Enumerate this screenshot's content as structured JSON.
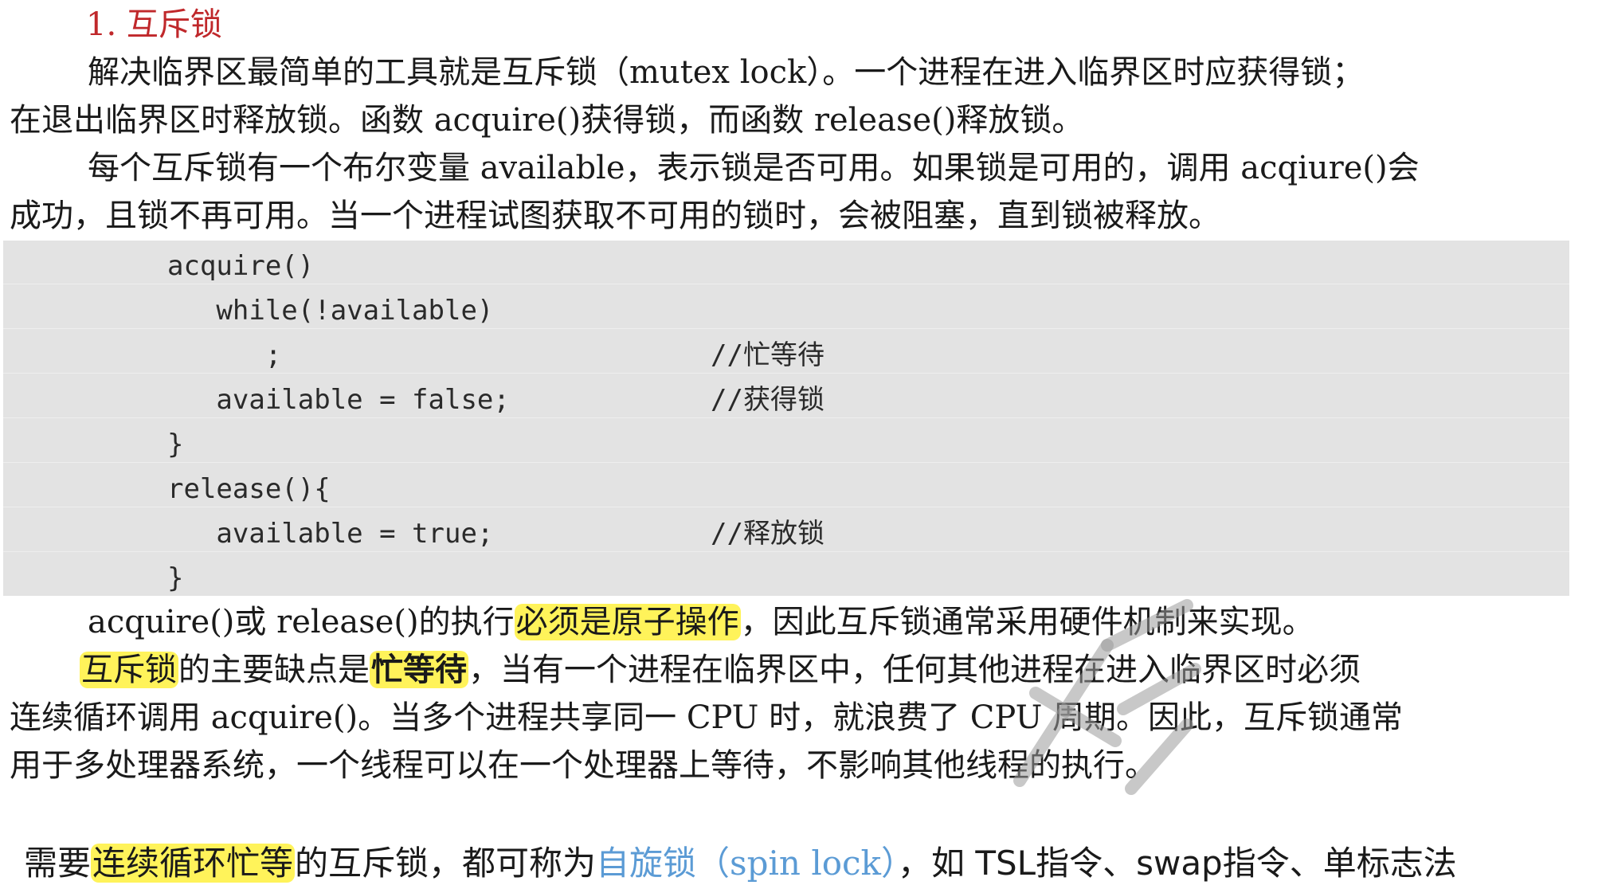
{
  "heading": "1. 互斥锁",
  "p1": {
    "line1": "解决临界区最简单的工具就是互斥锁（mutex lock）。一个进程在进入临界区时应获得锁；",
    "line2": "在退出临界区时释放锁。函数 acquire()获得锁，而函数 release()释放锁。"
  },
  "p2": {
    "line1": "每个互斥锁有一个布尔变量 available，表示锁是否可用。如果锁是可用的，调用 acqiure()会",
    "line2": "成功，且锁不再可用。当一个进程试图获取不可用的锁时，会被阻塞，直到锁被释放。"
  },
  "code": {
    "lines": [
      "acquire()",
      "   while(!available)",
      "      ;",
      "   available = false;",
      "}",
      "release(){",
      "   available = true;",
      "}"
    ],
    "comments": {
      "busy_wait": "//忙等待",
      "acquire_lock": "//获得锁",
      "release_lock": "//释放锁"
    }
  },
  "p3": {
    "before": "acquire()或 release()的执行",
    "highlight": "必须是原子操作",
    "after": "，因此互斥锁通常采用硬件机制来实现。"
  },
  "p4": {
    "hl1": "互斥锁",
    "mid1": "的主要缺点是",
    "hl2": "忙等待",
    "after1": "，当有一个进程在临界区中，任何其他进程在进入临界区时必须",
    "line2": "连续循环调用 acquire()。当多个进程共享同一 CPU 时，就浪费了 CPU 周期。因此，互斥锁通常",
    "line3": "用于多处理器系统，一个线程可以在一个处理器上等待，不影响其他线程的执行。"
  },
  "note": {
    "prefix": "需要",
    "highlight": "连续循环忙等",
    "mid": "的互斥锁，都可称为",
    "link": "自旋锁（spin lock）",
    "suffix": "，如 TSL指令、swap指令、单标志法"
  },
  "colors": {
    "heading": "#c0282b",
    "highlight": "#fff35a",
    "link": "#5b9bd5",
    "code_bg": "#e3e3e3"
  }
}
